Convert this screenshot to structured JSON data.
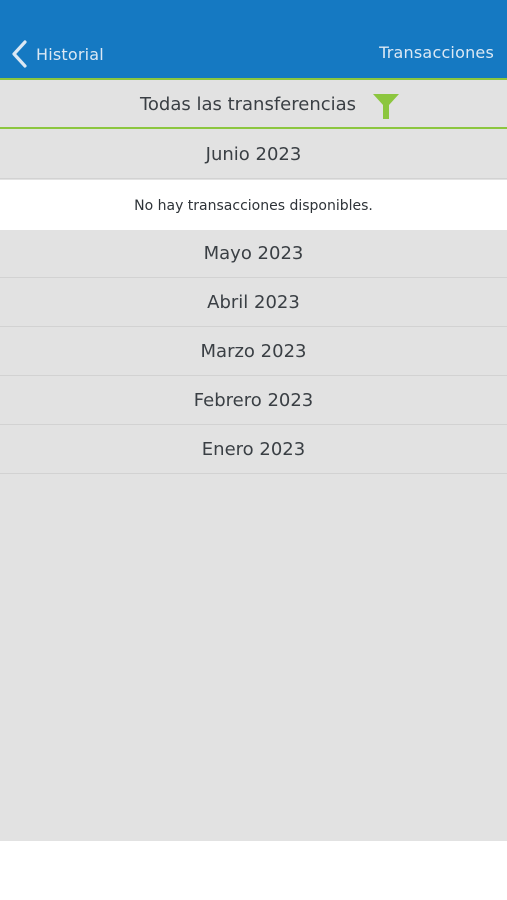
{
  "header": {
    "back_label": "Historial",
    "title": "Transacciones"
  },
  "filter": {
    "label": "Todas las transferencias"
  },
  "months": [
    {
      "label": "Junio 2023",
      "expanded": true,
      "empty_message": "No hay transacciones disponibles."
    },
    {
      "label": "Mayo 2023"
    },
    {
      "label": "Abril 2023"
    },
    {
      "label": "Marzo 2023"
    },
    {
      "label": "Febrero 2023"
    },
    {
      "label": "Enero 2023"
    }
  ],
  "colors": {
    "header_bg": "#1579c2",
    "accent": "#8cc63f",
    "list_bg": "#e2e2e2"
  },
  "icons": {
    "back": "chevron-left-icon",
    "filter": "funnel-icon"
  }
}
